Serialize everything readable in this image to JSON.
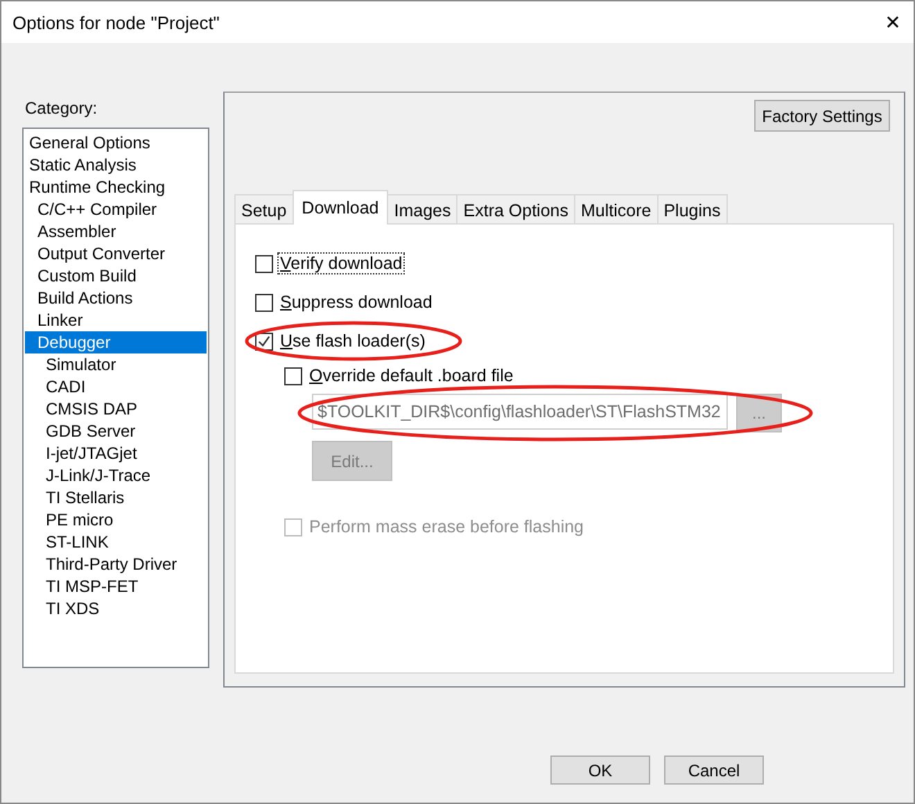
{
  "window": {
    "title": "Options for node \"Project\"",
    "close": "✕"
  },
  "category": {
    "label": "Category:",
    "items": [
      {
        "label": "General Options",
        "selected": false
      },
      {
        "label": "Static Analysis",
        "selected": false
      },
      {
        "label": "Runtime Checking",
        "selected": false,
        "children": [
          {
            "label": "C/C++ Compiler",
            "selected": false
          },
          {
            "label": "Assembler",
            "selected": false
          },
          {
            "label": "Output Converter",
            "selected": false
          },
          {
            "label": "Custom Build",
            "selected": false
          },
          {
            "label": "Build Actions",
            "selected": false
          },
          {
            "label": "Linker",
            "selected": false
          },
          {
            "label": "Debugger",
            "selected": true,
            "children": [
              {
                "label": "Simulator",
                "selected": false
              },
              {
                "label": "CADI",
                "selected": false
              },
              {
                "label": "CMSIS DAP",
                "selected": false
              },
              {
                "label": "GDB Server",
                "selected": false
              },
              {
                "label": "I-jet/JTAGjet",
                "selected": false
              },
              {
                "label": "J-Link/J-Trace",
                "selected": false
              },
              {
                "label": "TI Stellaris",
                "selected": false
              },
              {
                "label": "PE micro",
                "selected": false
              },
              {
                "label": "ST-LINK",
                "selected": false
              },
              {
                "label": "Third-Party Driver",
                "selected": false
              },
              {
                "label": "TI MSP-FET",
                "selected": false
              },
              {
                "label": "TI XDS",
                "selected": false
              }
            ]
          }
        ]
      }
    ]
  },
  "factory_button": "Factory Settings",
  "tabs": [
    {
      "label": "Setup",
      "selected": false
    },
    {
      "label": "Download",
      "selected": true
    },
    {
      "label": "Images",
      "selected": false
    },
    {
      "label": "Extra Options",
      "selected": false
    },
    {
      "label": "Multicore",
      "selected": false
    },
    {
      "label": "Plugins",
      "selected": false
    }
  ],
  "options": [
    {
      "kind": "checkbox",
      "label": "Verify download",
      "checked": false,
      "disabled": false,
      "focused": true,
      "underline_first": true
    },
    {
      "kind": "checkbox",
      "label": "Suppress download",
      "checked": false,
      "disabled": false,
      "focused": false,
      "underline_first": true
    },
    {
      "kind": "checkbox",
      "label": "Use flash loader(s)",
      "checked": true,
      "disabled": false,
      "focused": false,
      "underline_first": true,
      "circled": true
    },
    {
      "kind": "checkbox",
      "label": "Override default .board file",
      "checked": false,
      "disabled": false,
      "focused": false,
      "underline_first": true,
      "indented": true
    },
    {
      "kind": "path",
      "value": "$TOOLKIT_DIR$\\config\\flashloader\\ST\\FlashSTM32",
      "browse": "...",
      "disabled": true,
      "circled": true
    },
    {
      "kind": "button",
      "label": "Edit...",
      "disabled": true
    },
    {
      "kind": "checkbox",
      "label": "Perform mass erase before flashing",
      "checked": false,
      "disabled": true,
      "focused": false,
      "underline_first": false,
      "indented": true
    }
  ],
  "buttons": [
    {
      "label": "OK"
    },
    {
      "label": "Cancel"
    }
  ]
}
